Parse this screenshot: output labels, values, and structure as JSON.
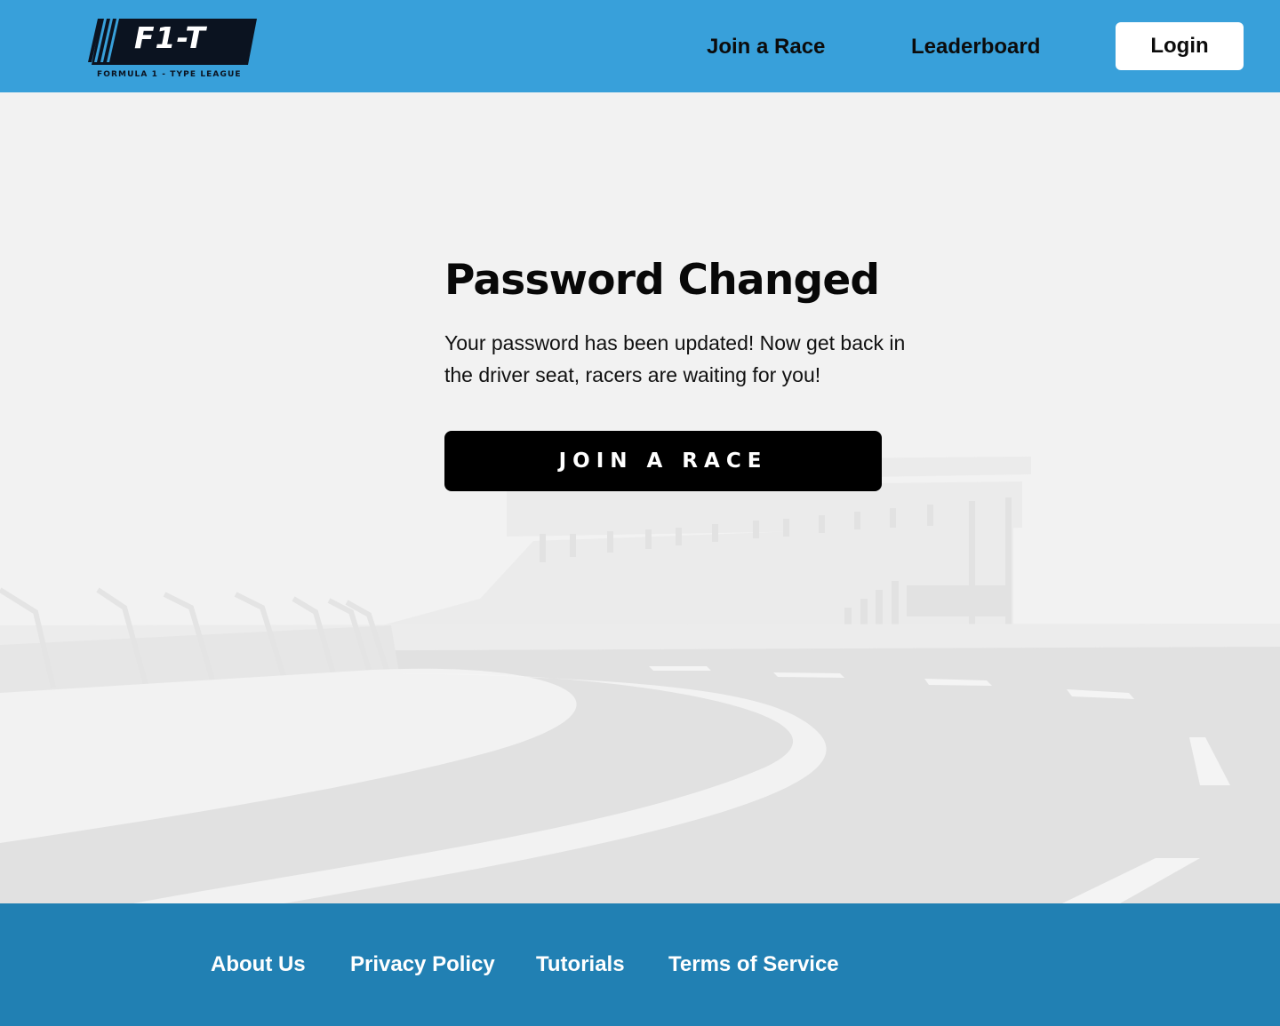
{
  "header": {
    "logo_text": "F1-T",
    "logo_tagline": "FORMULA 1 - TYPE LEAGUE",
    "nav": {
      "join_race": "Join a Race",
      "leaderboard": "Leaderboard",
      "login": "Login"
    }
  },
  "main": {
    "title": "Password Changed",
    "message": "Your password has been updated! Now get back in the driver seat, racers are waiting for you!",
    "cta_label": "JOIN A RACE"
  },
  "footer": {
    "links": {
      "about": "About Us",
      "privacy": "Privacy Policy",
      "tutorials": "Tutorials",
      "terms": "Terms of Service"
    }
  },
  "colors": {
    "header_bg": "#38a0da",
    "footer_bg": "#2180b3",
    "page_bg": "#f2f2f2",
    "cta_bg": "#000000"
  },
  "icons": [
    "race-track-illustration",
    "f1t-logo"
  ]
}
